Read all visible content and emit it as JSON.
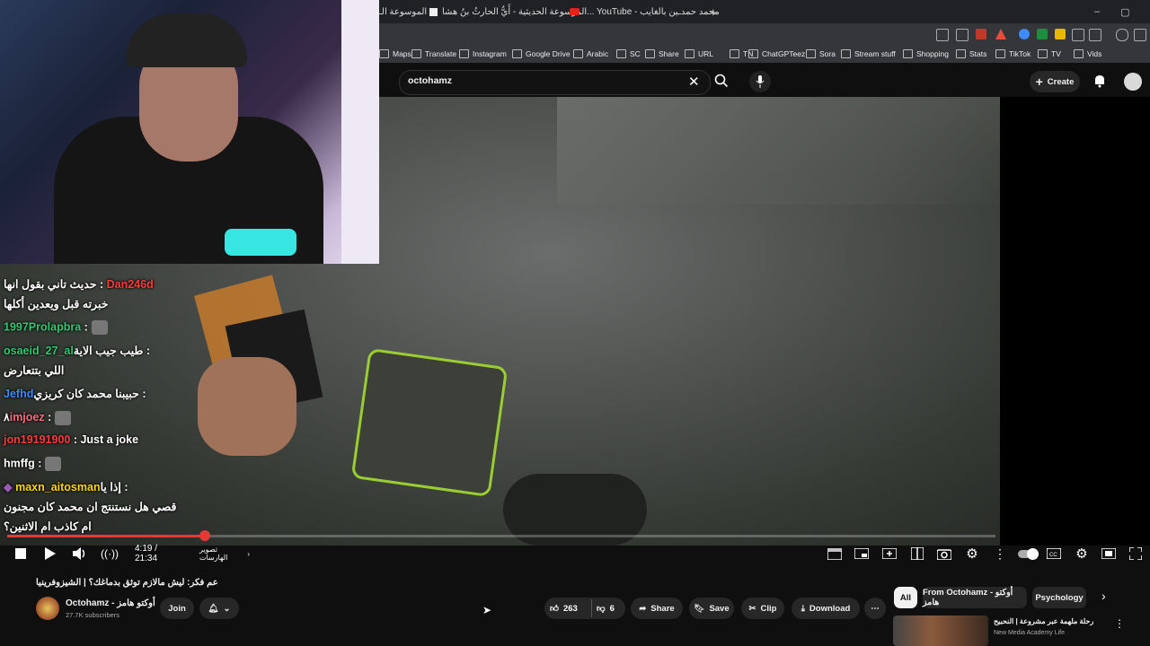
{
  "browser": {
    "tabs": [
      {
        "label": "الموسوعة الـ",
        "icon": "document-icon"
      },
      {
        "label": "الموسوعة الحديثية - أَيُّ الحارثُ بنُ هشا...",
        "icon": "document-icon"
      },
      {
        "label": "",
        "icon": "youtube-icon"
      },
      {
        "label": "YouTube - محمد حمدـين بالغايب",
        "icon": "youtube-icon"
      }
    ],
    "new_tab": "+",
    "window_controls": {
      "minimize": "–",
      "restore": "▢"
    },
    "bookmarks": [
      "Maps",
      "Translate",
      "Instagram",
      "Google Drive",
      "Arabic",
      "SC",
      "Share",
      "URL",
      "TN",
      "ChatGPTeez",
      "Sora",
      "Stream stuff",
      "Shopping",
      "Stats",
      "TikTok",
      "TV",
      "Vids"
    ]
  },
  "youtube_header": {
    "search_value": "octohamz",
    "create_label": "Create",
    "colors": {
      "accent": "#ff0000",
      "background": "#0f0f0f"
    }
  },
  "chat": [
    {
      "user": "",
      "text": "حديث تاني بقول انها : ",
      "color": "#ffffff"
    },
    {
      "user": "Dan246d",
      "text": "",
      "color": "#ff3b3b",
      "rtl_after": true
    },
    {
      "user": "",
      "text": "خبرته قبل ويعدين أكلها",
      "color": "#ffffff"
    },
    {
      "user": "1997Prolapbra",
      "text": " :",
      "color": "#2ecc71",
      "emote": true
    },
    {
      "user": "osaeid_27_al",
      "text": "طيب جيب الاية : ",
      "color": "#2ecc71"
    },
    {
      "user": "",
      "text": "اللي بتتعارض",
      "color": "#ffffff"
    },
    {
      "user": "Jefhd",
      "text": "حبيبنا محمد كان كريزي : ",
      "color": "#3d8bfd"
    },
    {
      "user": "imjoez",
      "text": " :",
      "color": "#ff6b81",
      "prefix": "٨",
      "emote": true
    },
    {
      "user": "jon19191900",
      "text": " : Just a joke",
      "color": "#ff3b3b"
    },
    {
      "user": "hmffg",
      "text": " :",
      "color": "#ffffff",
      "emote": true
    },
    {
      "user": "maxn_aitosman",
      "text": "إذا يا : ",
      "color": "#ffd700",
      "badge": true
    },
    {
      "user": "",
      "text": "قصي هل نستنتج ان محمد كان مجنون",
      "color": "#ffffff"
    },
    {
      "user": "",
      "text": "ام كاذب ام الاثنين؟",
      "color": "#ffffff"
    }
  ],
  "player": {
    "time_current": "4:19",
    "time_total": "21:34",
    "time_display": "4:19 / 21:34",
    "chapter": "تصوير الهارسات",
    "progress_fraction": 0.2
  },
  "video_info": {
    "title": "عم فكر: ليش مالازم توثق بدماغك؟ | الشيزوفرينيا",
    "channel_name": "Octohamz - أوكتو هامز",
    "subscribers": "27.7K subscribers",
    "join_label": "Join",
    "like_count": "263",
    "dislike_count": "6",
    "share_label": "Share",
    "save_label": "Save",
    "clip_label": "Clip",
    "download_label": "Download",
    "more_label": "⋯"
  },
  "recommendations": {
    "chips": [
      "All",
      "From Octohamz - أوكتو هامز",
      "Psychology"
    ],
    "first_item_title": "رحلة ملهمة عبر مشروعة | النحبيح",
    "first_item_channel": "New Media Academy Life"
  }
}
